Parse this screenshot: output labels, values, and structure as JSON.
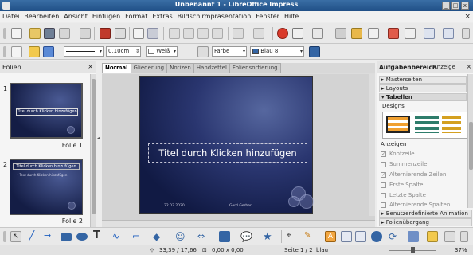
{
  "window": {
    "title": "Unbenannt 1 - LibreOffice Impress"
  },
  "menu": [
    "Datei",
    "Bearbeiten",
    "Ansicht",
    "Einfügen",
    "Format",
    "Extras",
    "Bildschirmpräsentation",
    "Fenster",
    "Hilfe"
  ],
  "toolbar2": {
    "line_width": "0,10cm",
    "line_color": "Weiß",
    "fill_type": "Farbe",
    "fill_color": "Blau 8"
  },
  "slides_pane": {
    "title": "Folien",
    "slides": [
      {
        "number": "1",
        "caption": "Folie 1",
        "thumb_text": "Titel durch Klicken hinzufügen"
      },
      {
        "number": "2",
        "caption": "Folie 2",
        "thumb_text": "Titel durch Klicken hinzufügen",
        "thumb_sub": "• Text durch Klicken hinzufügen"
      }
    ]
  },
  "view_tabs": [
    "Normal",
    "Gliederung",
    "Notizen",
    "Handzettel",
    "Foliensortierung"
  ],
  "active_view_tab": "Normal",
  "slide": {
    "title_placeholder": "Titel durch Klicken hinzufügen",
    "footer_date": "22.03.2020",
    "footer_author": "Gerd Gerber"
  },
  "task_pane": {
    "title": "Aufgabenbereich",
    "view_label": "Anzeige",
    "sections": [
      "Masterseiten",
      "Layouts",
      "Tabellen"
    ],
    "designs_label": "Designs",
    "show_label": "Anzeigen",
    "options": [
      {
        "label": "Kopfzeile",
        "checked": true
      },
      {
        "label": "Summenzeile",
        "checked": false
      },
      {
        "label": "Alternierende Zeilen",
        "checked": true
      },
      {
        "label": "Erste Spalte",
        "checked": false
      },
      {
        "label": "Letzte Spalte",
        "checked": false
      },
      {
        "label": "Alternierende Spalten",
        "checked": false
      }
    ],
    "bottom_sections": [
      "Benutzerdefinierte Animation",
      "Folienübergang"
    ]
  },
  "status_bar": {
    "position": "33,39 / 17,66",
    "size": "0,00 x 0,00",
    "page": "Seite 1 / 2",
    "master": "blau",
    "zoom": "37%"
  },
  "colors": {
    "accent": "#1f4f86",
    "slide_dark": "#111a44",
    "slide_light": "#56679f"
  }
}
